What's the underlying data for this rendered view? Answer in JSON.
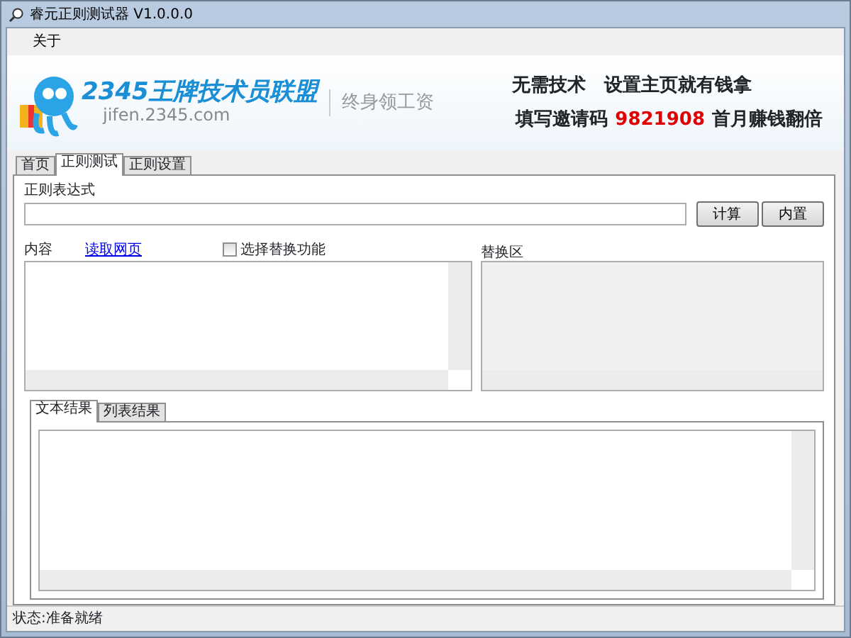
{
  "window": {
    "title": "睿元正则测试器 V1.0.0.0"
  },
  "menu": [
    {
      "label": "关于"
    }
  ],
  "banner": {
    "brand": "2345王牌技术员联盟",
    "url": "jifen.2345.com",
    "slogan": "终身领工资",
    "line1": "无需技术　设置主页就有钱拿",
    "line2_prefix": "填写邀请码",
    "invite_code": "9821908",
    "line2_suffix": "首月赚钱翻倍"
  },
  "tabs": [
    {
      "label": "首页",
      "selected": false
    },
    {
      "label": "正则测试",
      "selected": true
    },
    {
      "label": "正则设置",
      "selected": false
    }
  ],
  "regex": {
    "label": "正则表达式",
    "buttons": [
      "计算",
      "内置"
    ]
  },
  "content": {
    "label": "内容",
    "link": "读取网页",
    "checkbox": {
      "label": "选择替换功能",
      "checked": false
    }
  },
  "replace": {
    "label": "替换区"
  },
  "result_tabs": [
    {
      "label": "文本结果",
      "selected": true
    },
    {
      "label": "列表结果",
      "selected": false
    }
  ],
  "status_bar": "状态:准备就绪"
}
